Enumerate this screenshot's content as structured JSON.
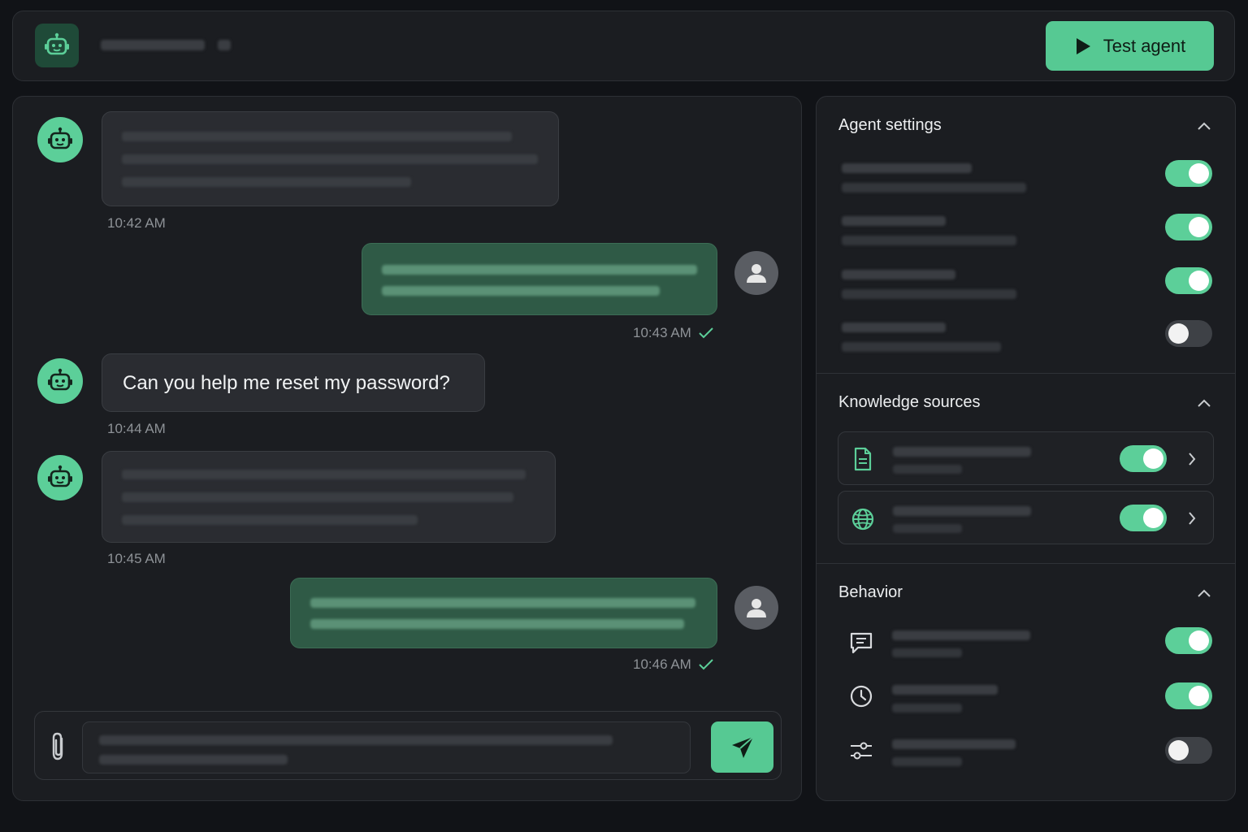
{
  "header": {
    "test_button_label": "Test agent",
    "logo_icon": "robot-icon",
    "play_icon": "play-icon"
  },
  "messages": [
    {
      "role": "bot",
      "text": "",
      "time": "10:42 AM"
    },
    {
      "role": "user",
      "text": "",
      "time": "10:43 AM",
      "read": true
    },
    {
      "role": "bot",
      "text": "Can you help me reset my password?",
      "time": "10:44 AM"
    },
    {
      "role": "bot",
      "text": "",
      "time": "10:45 AM"
    },
    {
      "role": "user",
      "text": "",
      "time": "10:46 AM",
      "read": true
    }
  ],
  "composer": {
    "attach_icon": "paperclip-icon",
    "send_icon": "send-icon"
  },
  "settings": {
    "agent_settings": {
      "title": "Agent settings",
      "toggles": [
        true,
        true,
        true,
        false
      ]
    },
    "knowledge_sources": {
      "title": "Knowledge sources",
      "items": [
        {
          "icon": "document-icon",
          "enabled": true
        },
        {
          "icon": "globe-icon",
          "enabled": true
        }
      ]
    },
    "behavior": {
      "title": "Behavior",
      "items": [
        {
          "icon": "message-icon",
          "enabled": true
        },
        {
          "icon": "clock-icon",
          "enabled": true
        },
        {
          "icon": "sliders-icon",
          "enabled": false
        }
      ]
    }
  },
  "colors": {
    "accent": "#5ccf99",
    "background": "#111317",
    "panel": "#1b1d21",
    "user_bubble": "#2f5a46"
  }
}
